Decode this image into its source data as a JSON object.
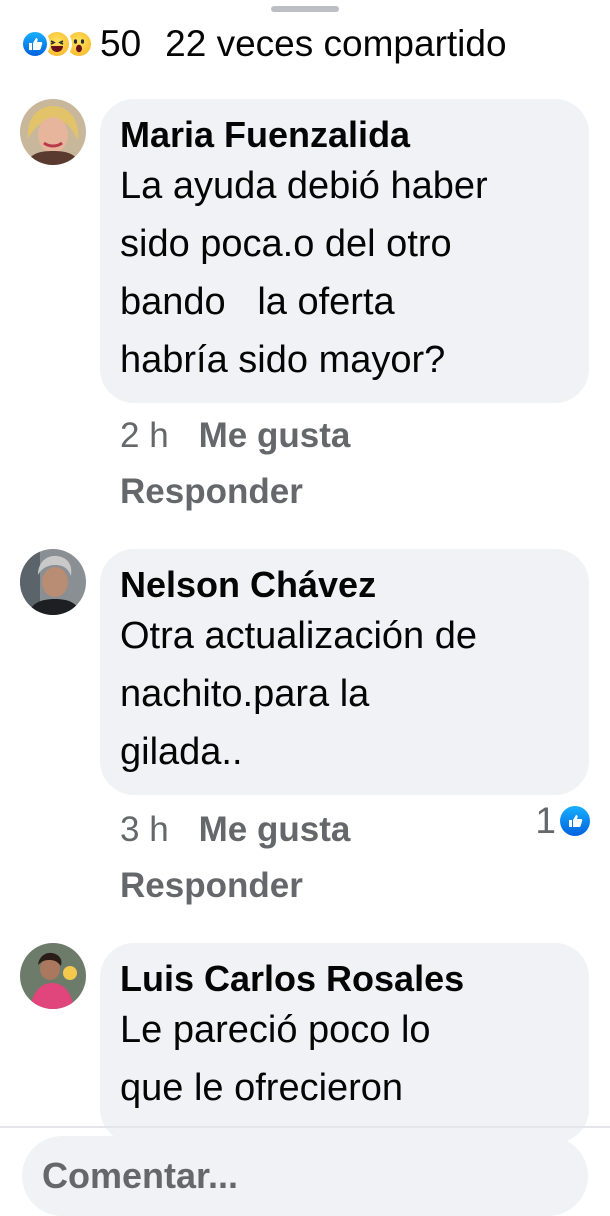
{
  "reactions": {
    "icons": [
      "like-icon",
      "haha-icon",
      "wow-icon"
    ],
    "count": "50",
    "shares": "22 veces compartido",
    "colors": {
      "like": "#0866ff",
      "emoji": "#f7b125"
    }
  },
  "comments": [
    {
      "author": "Maria Fuenzalida",
      "text": "La ayuda debió haber\nsido poca.o del otro\nbando   la oferta\nhabría sido mayor?",
      "time": "2 h",
      "like_label": "Me gusta",
      "reply_label": "Responder"
    },
    {
      "author": "Nelson Chávez",
      "text": "Otra actualización de\nnachito.para la\ngilada..",
      "time": "3 h",
      "like_label": "Me gusta",
      "reply_label": "Responder",
      "like_count": "1"
    },
    {
      "author": "Luis Carlos Rosales",
      "text": "Le pareció poco lo\nque le ofrecieron"
    }
  ],
  "composer": {
    "placeholder": "Comentar..."
  },
  "colors": {
    "bubble_bg": "#f0f2f5",
    "meta_text": "#65676b",
    "text": "#050505"
  }
}
